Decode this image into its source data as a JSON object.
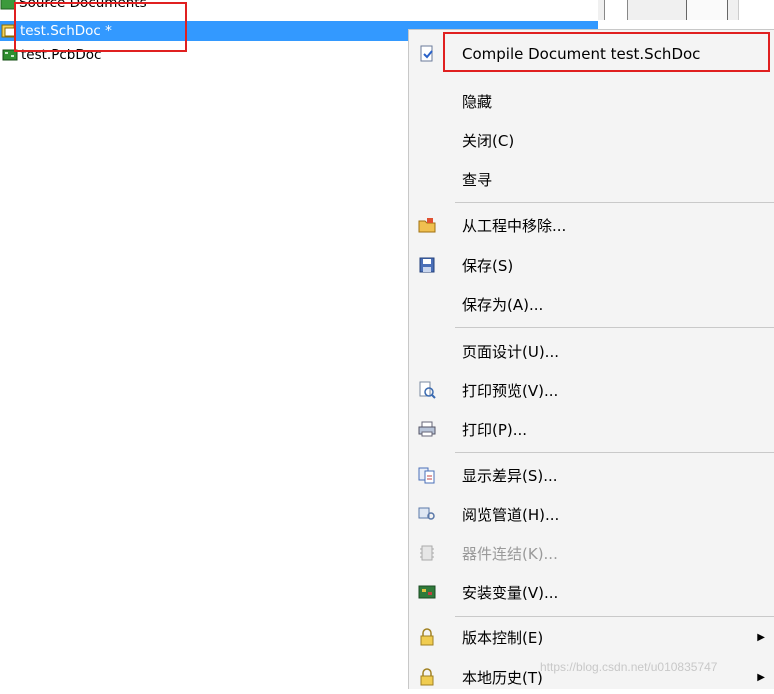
{
  "tree": {
    "source_folder": "Source Documents",
    "schematic_file": "test.SchDoc *",
    "pcb_file": "test.PcbDoc"
  },
  "menu": {
    "items": [
      {
        "label": "Compile Document test.SchDoc",
        "icon": "compile-icon"
      },
      {
        "label": "隐藏",
        "icon": ""
      },
      {
        "label": "关闭(C)",
        "icon": ""
      },
      {
        "label": "查寻",
        "icon": ""
      },
      {
        "label": "从工程中移除...",
        "icon": "remove-folder-icon"
      },
      {
        "label": "保存(S)",
        "icon": "save-icon"
      },
      {
        "label": "保存为(A)...",
        "icon": ""
      },
      {
        "label": "页面设计(U)...",
        "icon": ""
      },
      {
        "label": "打印预览(V)...",
        "icon": "print-preview-icon"
      },
      {
        "label": "打印(P)...",
        "icon": "printer-icon"
      },
      {
        "label": "显示差异(S)...",
        "icon": "diff-icon"
      },
      {
        "label": "阅览管道(H)...",
        "icon": "channel-icon"
      },
      {
        "label": "器件连结(K)...",
        "icon": "component-link-icon"
      },
      {
        "label": "安装变量(V)...",
        "icon": "variant-icon"
      },
      {
        "label": "版本控制(E)",
        "icon": "lock-icon"
      },
      {
        "label": "本地历史(T)",
        "icon": "lock-icon"
      }
    ]
  },
  "watermark": "https://blog.csdn.net/u010835747",
  "colors": {
    "selection": "#3399ff",
    "highlight_box": "#e02020",
    "menu_bg": "#f4f4f4"
  }
}
